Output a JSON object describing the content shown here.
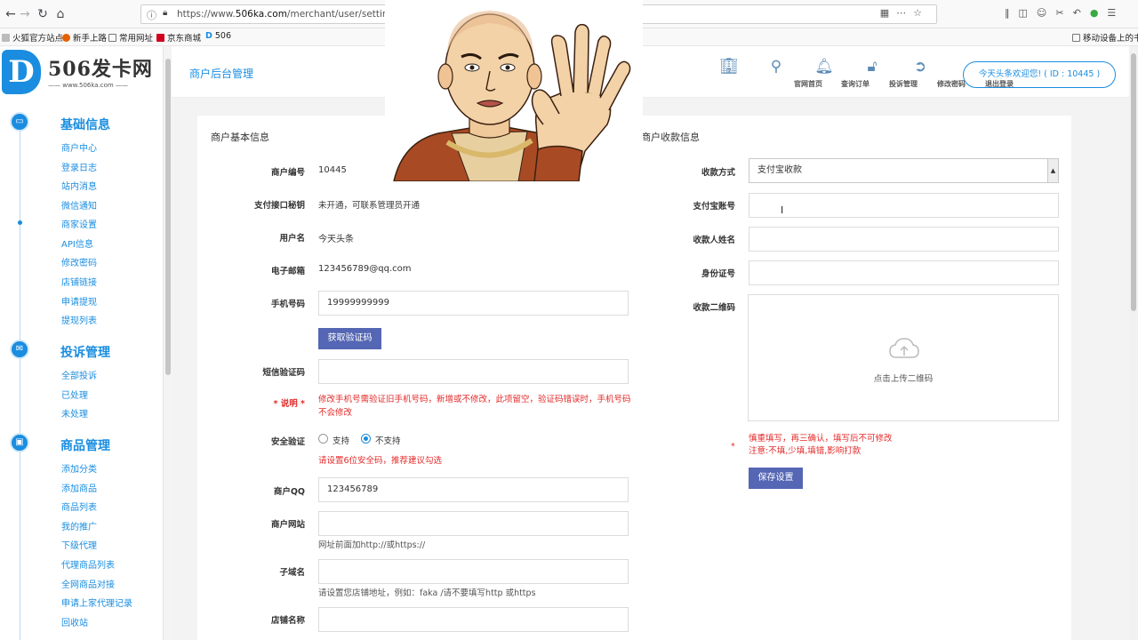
{
  "browser": {
    "url_prefix": "https://www.",
    "url_domain": "506ka.com",
    "url_path": "/merchant/user/settings",
    "bookmarks": [
      "火狐官方站点",
      "新手上路",
      "常用网址",
      "京东商城",
      "506"
    ],
    "mobile_bookmarks": "移动设备上的书签"
  },
  "sidebar": {
    "logo_text": "506发卡网",
    "logo_letter": "D",
    "logo_sub": "www.506ka.com",
    "groups": [
      {
        "title": "基础信息",
        "items": [
          "商户中心",
          "登录日志",
          "站内消息",
          "微信通知",
          "商家设置",
          "API信息",
          "修改密码",
          "店铺链接",
          "申请提现",
          "提现列表"
        ]
      },
      {
        "title": "投诉管理",
        "items": [
          "全部投诉",
          "已处理",
          "未处理"
        ]
      },
      {
        "title": "商品管理",
        "items": [
          "添加分类",
          "添加商品",
          "商品列表",
          "我的推广",
          "下级代理",
          "代理商品列表",
          "全网商品对接",
          "申请上家代理记录",
          "回收站"
        ]
      }
    ]
  },
  "header": {
    "title": "商户后台管理",
    "nav": [
      "官网首页",
      "查询订单",
      "投诉管理",
      "修改密码",
      "退出登录"
    ],
    "welcome": "今天头条欢迎您! ( ID : 10445 )"
  },
  "basic_info": {
    "section_title": "商户基本信息",
    "merchant_id_label": "商户编号",
    "merchant_id": "10445",
    "api_key_label": "支付接口秘钥",
    "api_key_value": "未开通，可联系管理员开通",
    "username_label": "用户名",
    "username": "今天头条",
    "email_label": "电子邮箱",
    "email": "123456789@qq.com",
    "phone_label": "手机号码",
    "phone": "19999999999",
    "get_code_button": "获取验证码",
    "sms_label": "短信验证码",
    "sms_value": "",
    "note_label": "* 说明 *",
    "note_text": "修改手机号需验证旧手机号码，新增或不修改，此项留空，验证码错误时，手机号码不会修改",
    "security_label": "安全验证",
    "security_options": [
      "支持",
      "不支持"
    ],
    "security_hint": "请设置6位安全码，推荐建议勾选",
    "qq_label": "商户QQ",
    "qq": "123456789",
    "website_label": "商户网站",
    "website_value": "",
    "website_hint": "网址前面加http://或https://",
    "subdomain_label": "子域名",
    "subdomain_value": "",
    "subdomain_hint": "请设置您店铺地址，例如：faka /请不要填写http 或https",
    "shop_name_label": "店铺名称",
    "shop_name_value": ""
  },
  "payment_info": {
    "section_title": "商户收款信息",
    "method_label": "收款方式",
    "method_value": "支付宝收款",
    "account_label": "支付宝账号",
    "account_value": "",
    "payee_label": "收款人姓名",
    "payee_value": "",
    "idcard_label": "身份证号",
    "idcard_value": "",
    "qrcode_label": "收款二维码",
    "upload_text": "点击上传二维码",
    "warn_star": "*",
    "warn_line1": "慎重填写，再三确认，填写后不可修改",
    "warn_line2": "注意:不填,少填,填错,影响打款",
    "save_button": "保存设置"
  },
  "colors": {
    "accent": "#1a8de0",
    "button": "#5466b4",
    "warning": "#e32b2b"
  }
}
